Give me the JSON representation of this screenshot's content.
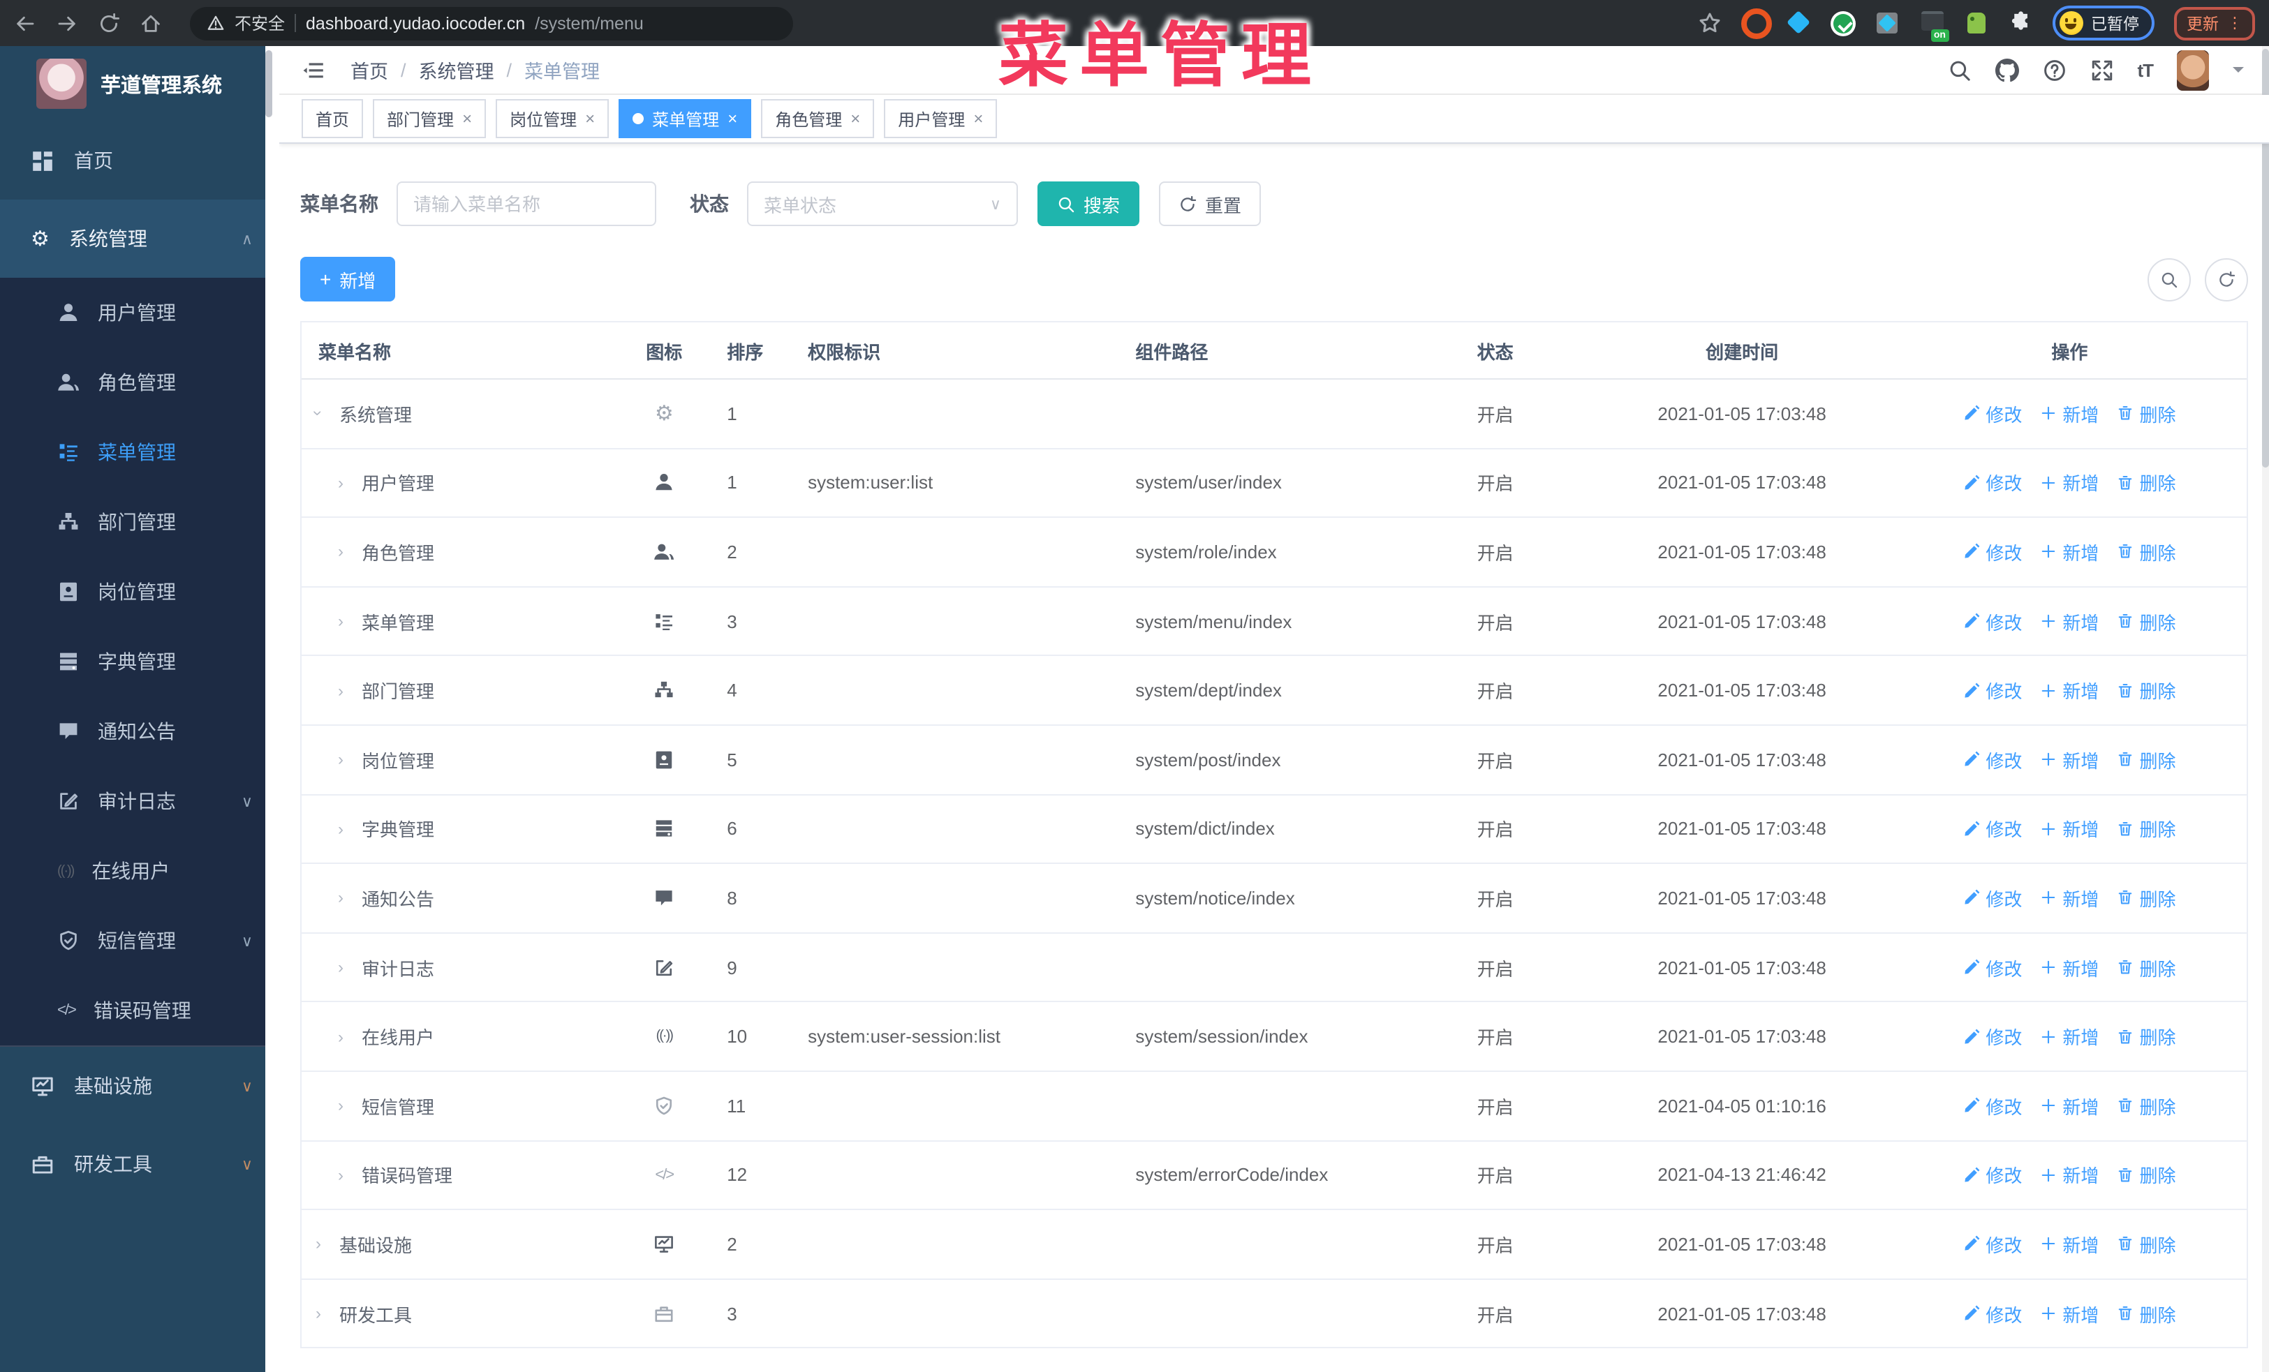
{
  "browser": {
    "security_label": "不安全",
    "url_host": "dashboard.yudao.iocoder.cn",
    "url_path": "/system/menu",
    "on_badge": "on",
    "paused_badge": "已暂停",
    "update_button": "更新",
    "extension_icons": [
      "bookmark-star",
      "ubuntu-ring",
      "blue-gem",
      "green-check",
      "squares-gem",
      "server-on",
      "green-robot",
      "puzzle"
    ]
  },
  "overlay": {
    "text": "菜单管理",
    "color": "#f2395c"
  },
  "sidebar": {
    "logo_title": "芋道管理系统",
    "top": [
      {
        "label": "首页",
        "icon": "dashboard"
      },
      {
        "label": "系统管理",
        "icon": "gear",
        "expanded": true
      }
    ],
    "sub": [
      {
        "label": "用户管理",
        "icon": "user"
      },
      {
        "label": "角色管理",
        "icon": "users"
      },
      {
        "label": "菜单管理",
        "icon": "tree-table",
        "active": true
      },
      {
        "label": "部门管理",
        "icon": "tree"
      },
      {
        "label": "岗位管理",
        "icon": "badge"
      },
      {
        "label": "字典管理",
        "icon": "dict"
      },
      {
        "label": "通知公告",
        "icon": "message"
      },
      {
        "label": "审计日志",
        "icon": "log",
        "collapsible": true
      },
      {
        "label": "在线用户",
        "icon": "online"
      },
      {
        "label": "短信管理",
        "icon": "shield",
        "collapsible": true
      },
      {
        "label": "错误码管理",
        "icon": "code"
      }
    ],
    "bottom": [
      {
        "label": "基础设施",
        "icon": "monitor",
        "collapsible": true
      },
      {
        "label": "研发工具",
        "icon": "toolbox",
        "collapsible": true
      }
    ]
  },
  "header": {
    "breadcrumb": [
      "首页",
      "系统管理",
      "菜单管理"
    ],
    "separator": "/",
    "right_icons": [
      "search",
      "github",
      "question",
      "fullscreen",
      "font-size",
      "avatar",
      "caret-down"
    ],
    "font_size_icon": "tT"
  },
  "tags": [
    {
      "label": "首页",
      "closable": false,
      "active": false
    },
    {
      "label": "部门管理",
      "closable": true,
      "active": false
    },
    {
      "label": "岗位管理",
      "closable": true,
      "active": false
    },
    {
      "label": "菜单管理",
      "closable": true,
      "active": true
    },
    {
      "label": "角色管理",
      "closable": true,
      "active": false
    },
    {
      "label": "用户管理",
      "closable": true,
      "active": false
    }
  ],
  "close_glyph": "×",
  "filters": {
    "name_label": "菜单名称",
    "name_placeholder": "请输入菜单名称",
    "status_label": "状态",
    "status_placeholder": "菜单状态",
    "search_label": "搜索",
    "reset_label": "重置"
  },
  "toolbar": {
    "add_label": "新增",
    "plus_glyph": "+",
    "right_buttons": [
      "show-search",
      "refresh"
    ]
  },
  "table": {
    "columns": [
      "菜单名称",
      "图标",
      "排序",
      "权限标识",
      "组件路径",
      "状态",
      "创建时间",
      "操作"
    ],
    "action_labels": {
      "edit": "修改",
      "add": "新增",
      "delete": "删除"
    },
    "rows": [
      {
        "name": "系统管理",
        "icon": "gear",
        "order": "1",
        "permission": "",
        "path": "",
        "status": "开启",
        "created": "2021-01-05 17:03:48",
        "level": 0,
        "expanded": true
      },
      {
        "name": "用户管理",
        "icon": "user",
        "order": "1",
        "permission": "system:user:list",
        "path": "system/user/index",
        "status": "开启",
        "created": "2021-01-05 17:03:48",
        "level": 1
      },
      {
        "name": "角色管理",
        "icon": "users",
        "order": "2",
        "permission": "",
        "path": "system/role/index",
        "status": "开启",
        "created": "2021-01-05 17:03:48",
        "level": 1
      },
      {
        "name": "菜单管理",
        "icon": "tree-table",
        "order": "3",
        "permission": "",
        "path": "system/menu/index",
        "status": "开启",
        "created": "2021-01-05 17:03:48",
        "level": 1
      },
      {
        "name": "部门管理",
        "icon": "tree",
        "order": "4",
        "permission": "",
        "path": "system/dept/index",
        "status": "开启",
        "created": "2021-01-05 17:03:48",
        "level": 1
      },
      {
        "name": "岗位管理",
        "icon": "badge",
        "order": "5",
        "permission": "",
        "path": "system/post/index",
        "status": "开启",
        "created": "2021-01-05 17:03:48",
        "level": 1
      },
      {
        "name": "字典管理",
        "icon": "dict",
        "order": "6",
        "permission": "",
        "path": "system/dict/index",
        "status": "开启",
        "created": "2021-01-05 17:03:48",
        "level": 1
      },
      {
        "name": "通知公告",
        "icon": "message",
        "order": "8",
        "permission": "",
        "path": "system/notice/index",
        "status": "开启",
        "created": "2021-01-05 17:03:48",
        "level": 1
      },
      {
        "name": "审计日志",
        "icon": "log",
        "order": "9",
        "permission": "",
        "path": "",
        "status": "开启",
        "created": "2021-01-05 17:03:48",
        "level": 1
      },
      {
        "name": "在线用户",
        "icon": "online",
        "order": "10",
        "permission": "system:user-session:list",
        "path": "system/session/index",
        "status": "开启",
        "created": "2021-01-05 17:03:48",
        "level": 1
      },
      {
        "name": "短信管理",
        "icon": "shield",
        "order": "11",
        "permission": "",
        "path": "",
        "status": "开启",
        "created": "2021-04-05 01:10:16",
        "level": 1
      },
      {
        "name": "错误码管理",
        "icon": "code",
        "order": "12",
        "permission": "",
        "path": "system/errorCode/index",
        "status": "开启",
        "created": "2021-04-13 21:46:42",
        "level": 1
      },
      {
        "name": "基础设施",
        "icon": "monitor",
        "order": "2",
        "permission": "",
        "path": "",
        "status": "开启",
        "created": "2021-01-05 17:03:48",
        "level": 0
      },
      {
        "name": "研发工具",
        "icon": "toolbox",
        "order": "3",
        "permission": "",
        "path": "",
        "status": "开启",
        "created": "2021-01-05 17:03:48",
        "level": 0
      }
    ]
  },
  "colors": {
    "accent_blue": "#409eff",
    "teal_button": "#1fb5ad",
    "overlay_pink": "#f2395c",
    "sidebar_bg": "#254760",
    "submenu_bg": "#1d2b44",
    "link_blue": "#409eff"
  }
}
